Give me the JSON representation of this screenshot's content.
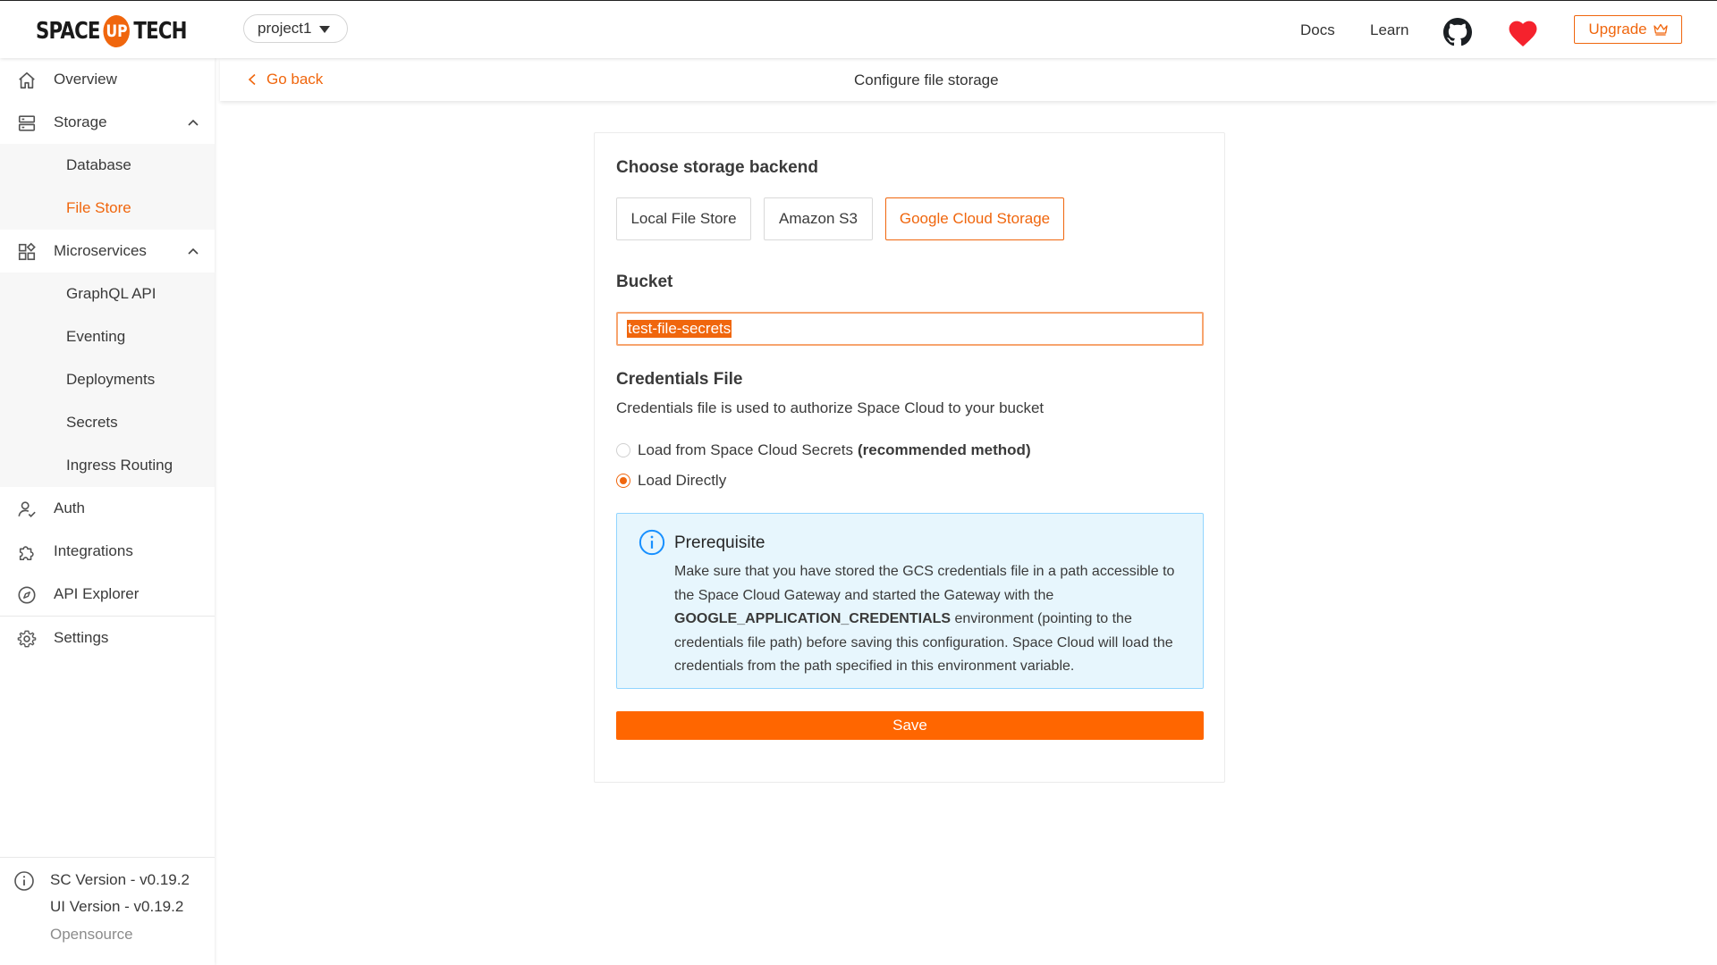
{
  "brand": {
    "logo_left": "SPACE",
    "logo_mid": "UP",
    "logo_right": "TECH"
  },
  "header": {
    "project": "project1",
    "links": [
      "Docs",
      "Learn"
    ],
    "upgrade_label": "Upgrade",
    "accent_color": "#f0660d"
  },
  "sidebar": {
    "items": [
      {
        "label": "Overview",
        "icon": "home-icon"
      },
      {
        "label": "Storage",
        "icon": "storage-icon",
        "expanded": true,
        "children": [
          {
            "label": "Database"
          },
          {
            "label": "File Store",
            "active": true
          }
        ]
      },
      {
        "label": "Microservices",
        "icon": "apps-icon",
        "expanded": true,
        "children": [
          {
            "label": "GraphQL API"
          },
          {
            "label": "Eventing"
          },
          {
            "label": "Deployments"
          },
          {
            "label": "Secrets"
          },
          {
            "label": "Ingress Routing"
          }
        ]
      },
      {
        "label": "Auth",
        "icon": "user-check-icon"
      },
      {
        "label": "Integrations",
        "icon": "puzzle-icon"
      },
      {
        "label": "API Explorer",
        "icon": "compass-icon"
      },
      {
        "label": "Settings",
        "icon": "gear-icon"
      }
    ],
    "sc_version": "SC Version - v0.19.2",
    "ui_version": "UI Version - v0.19.2",
    "edition": "Opensource"
  },
  "subheader": {
    "back_label": "Go back",
    "title": "Configure file storage"
  },
  "form": {
    "backend_title": "Choose storage backend",
    "backends": [
      {
        "label": "Local File Store",
        "selected": false
      },
      {
        "label": "Amazon S3",
        "selected": false
      },
      {
        "label": "Google Cloud Storage",
        "selected": true
      }
    ],
    "bucket_label": "Bucket",
    "bucket_value": "test-file-secrets",
    "credentials_label": "Credentials File",
    "credentials_desc": "Credentials file is used to authorize Space Cloud to your bucket",
    "radio_secrets": "Load from Space Cloud Secrets",
    "radio_secrets_bold": "(recommended method)",
    "radio_direct": "Load Directly",
    "selected_radio": "Load Directly",
    "alert": {
      "title": "Prerequisite",
      "body_1": "Make sure that you have stored the GCS credentials file in a path accessible to the Space Cloud Gateway and started the Gateway with the ",
      "body_env": "GOOGLE_APPLICATION_CREDENTIALS",
      "body_2": " environment (pointing to the credentials file path) before saving this configuration. Space Cloud will load the credentials from the path specified in this environment variable."
    },
    "save_label": "Save"
  }
}
